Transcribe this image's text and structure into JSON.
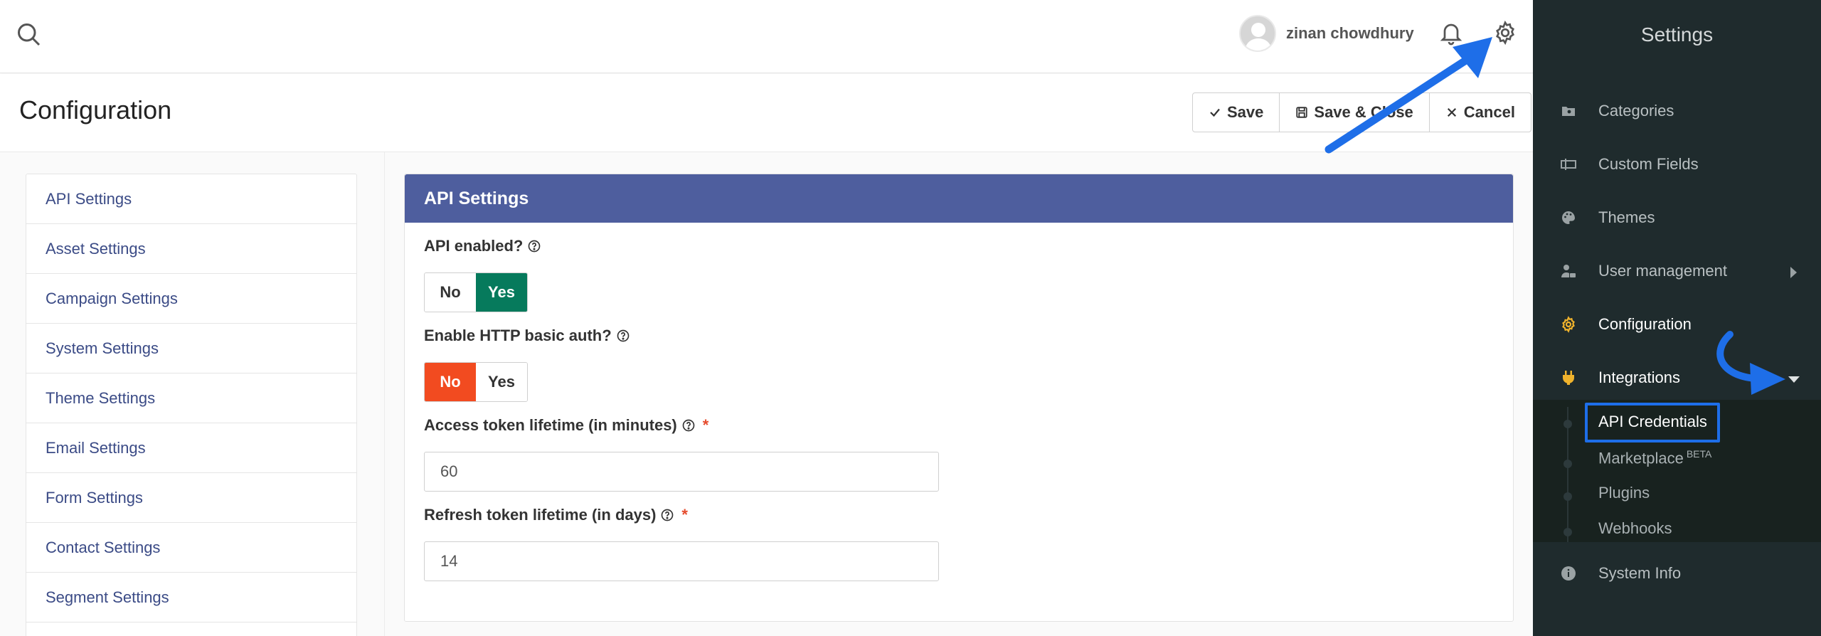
{
  "topbar": {
    "user_name": "zinan chowdhury",
    "icons": [
      "search-icon",
      "avatar",
      "bell-icon",
      "gear-icon"
    ]
  },
  "page": {
    "title": "Configuration",
    "actions": {
      "save": "Save",
      "save_close": "Save & Close",
      "cancel": "Cancel"
    }
  },
  "subnav": {
    "items": [
      {
        "label": "API Settings"
      },
      {
        "label": "Asset Settings"
      },
      {
        "label": "Campaign Settings"
      },
      {
        "label": "System Settings"
      },
      {
        "label": "Theme Settings"
      },
      {
        "label": "Email Settings"
      },
      {
        "label": "Form Settings"
      },
      {
        "label": "Contact Settings"
      },
      {
        "label": "Segment Settings"
      }
    ]
  },
  "panel": {
    "title": "API Settings",
    "api_enabled": {
      "label": "API enabled?",
      "no": "No",
      "yes": "Yes",
      "selected": "Yes"
    },
    "http_auth": {
      "label": "Enable HTTP basic auth?",
      "no": "No",
      "yes": "Yes",
      "selected": "No"
    },
    "access_token": {
      "label": "Access token lifetime (in minutes)",
      "required": "*",
      "value": "60"
    },
    "refresh_token": {
      "label": "Refresh token lifetime (in days)",
      "required": "*",
      "value": "14"
    }
  },
  "sidebar": {
    "title": "Settings",
    "items": [
      {
        "label": "Categories",
        "icon": "folder-icon"
      },
      {
        "label": "Custom Fields",
        "icon": "text-field-icon"
      },
      {
        "label": "Themes",
        "icon": "palette-icon"
      },
      {
        "label": "User management",
        "icon": "user-lock-icon"
      },
      {
        "label": "Configuration",
        "icon": "gear-icon"
      },
      {
        "label": "Integrations",
        "icon": "plug-icon"
      },
      {
        "label": "System Info",
        "icon": "info-icon"
      }
    ],
    "integrations_sub": [
      {
        "label": "API Credentials"
      },
      {
        "label": "Marketplace",
        "badge": "BETA"
      },
      {
        "label": "Plugins"
      },
      {
        "label": "Webhooks"
      }
    ]
  },
  "colors": {
    "panel_header": "#4e5e9e",
    "yes_active": "#067a5c",
    "no_active": "#f24b20",
    "sidebar_bg": "#1f2b2d",
    "active_icon": "#f0b32c",
    "annotation_blue": "#1e6ee8",
    "link": "#3b4b86"
  }
}
